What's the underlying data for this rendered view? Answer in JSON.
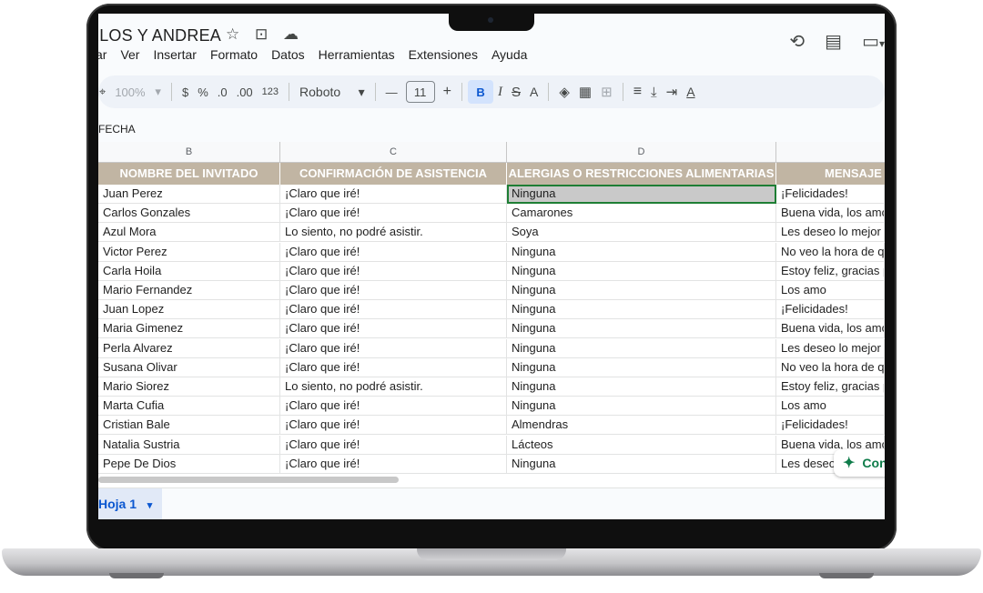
{
  "doc": {
    "title": "RLOS Y ANDREA",
    "star_icon": "☆",
    "folder_icon": "⊡",
    "cloud_icon": "☁"
  },
  "menu": [
    "itar",
    "Ver",
    "Insertar",
    "Formato",
    "Datos",
    "Herramientas",
    "Extensiones",
    "Ayuda"
  ],
  "right_icons": {
    "history": "⟲",
    "comment": "▤",
    "meet": "▭",
    "meet_caret": "▾"
  },
  "toolbar": {
    "paint_format": "⌖",
    "zoom": "100%",
    "zoom_caret": "▾",
    "currency": "$",
    "percent": "%",
    "decrease_decimal": ".0",
    "increase_decimal": ".00",
    "number_format": "123",
    "font": "Roboto",
    "font_caret": "▾",
    "minus": "—",
    "font_size": "11",
    "plus": "+",
    "bold": "B",
    "italic": "I",
    "strike": "S",
    "text_color": "A",
    "fill": "◈",
    "borders": "▦",
    "merge": "⊞",
    "align": "≡",
    "valign": "⤓",
    "wrap": "⇥",
    "rotate": "A"
  },
  "namebox": "FECHA",
  "columns": [
    "B",
    "C",
    "D",
    ""
  ],
  "headers": [
    "NOMBRE DEL INVITADO",
    "CONFIRMACIÓN DE ASISTENCIA",
    "ALERGIAS O RESTRICCIONES ALIMENTARIAS",
    "MENSAJE"
  ],
  "rows": [
    [
      "Juan Perez",
      "¡Claro que iré!",
      "Ninguna",
      "¡Felicidades!"
    ],
    [
      "Carlos Gonzales",
      "¡Claro que iré!",
      "Camarones",
      "Buena vida, los amo"
    ],
    [
      "Azul Mora",
      "Lo siento, no podré asistir.",
      "Soya",
      "Les deseo lo mejor"
    ],
    [
      "Victor Perez",
      "¡Claro que iré!",
      "Ninguna",
      "No veo la hora de qu"
    ],
    [
      "Carla Hoila",
      "¡Claro que iré!",
      "Ninguna",
      "Estoy feliz, gracias p"
    ],
    [
      "Mario Fernandez",
      "¡Claro que iré!",
      "Ninguna",
      "Los amo"
    ],
    [
      "Juan Lopez",
      "¡Claro que iré!",
      "Ninguna",
      "¡Felicidades!"
    ],
    [
      "Maria Gimenez",
      "¡Claro que iré!",
      "Ninguna",
      "Buena vida, los amo"
    ],
    [
      "Perla Alvarez",
      "¡Claro que iré!",
      "Ninguna",
      "Les deseo lo mejor"
    ],
    [
      "Susana Olivar",
      "¡Claro que iré!",
      "Ninguna",
      "No veo la hora de qu"
    ],
    [
      "Mario Siorez",
      "Lo siento, no podré asistir.",
      "Ninguna",
      "Estoy feliz, gracias p"
    ],
    [
      "Marta Cufia",
      "¡Claro que iré!",
      "Ninguna",
      "Los amo"
    ],
    [
      "Cristian Bale",
      "¡Claro que iré!",
      "Almendras",
      "¡Felicidades!"
    ],
    [
      "Natalia Sustria",
      "¡Claro que iré!",
      "Lácteos",
      "Buena vida, los amo"
    ],
    [
      "Pepe De Dios",
      "¡Claro que iré!",
      "Ninguna",
      "Les deseo"
    ]
  ],
  "chip": {
    "icon": "✦",
    "label": "Con"
  },
  "sheet_tab": {
    "label": "Hoja 1",
    "caret": "▾"
  },
  "colors": {
    "header_bg": "#c1b5a3",
    "selection_border": "#1e7e34",
    "accent": "#0b57d0"
  }
}
